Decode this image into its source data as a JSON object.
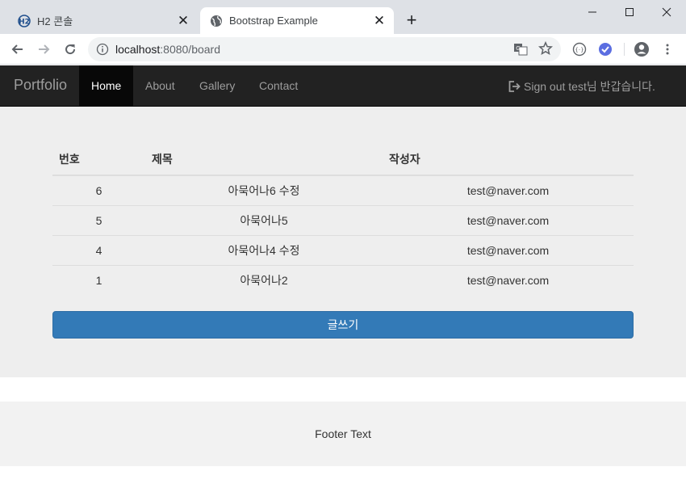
{
  "browser": {
    "tabs": [
      {
        "title": "H2 콘솔",
        "active": false
      },
      {
        "title": "Bootstrap Example",
        "active": true
      }
    ],
    "url": {
      "host": "localhost",
      "path": ":8080/board"
    }
  },
  "navbar": {
    "brand": "Portfolio",
    "links": [
      "Home",
      "About",
      "Gallery",
      "Contact"
    ],
    "active_link": "Home",
    "right_text": "Sign out test님 반갑습니다."
  },
  "board": {
    "headers": [
      "번호",
      "제목",
      "작성자"
    ],
    "rows": [
      {
        "num": "6",
        "title": "아묵어나6 수정",
        "writer": "test@naver.com"
      },
      {
        "num": "5",
        "title": "아묵어나5",
        "writer": "test@naver.com"
      },
      {
        "num": "4",
        "title": "아묵어나4 수정",
        "writer": "test@naver.com"
      },
      {
        "num": "1",
        "title": "아묵어나2",
        "writer": "test@naver.com"
      }
    ],
    "write_button": "글쓰기"
  },
  "footer": {
    "text": "Footer Text"
  },
  "colors": {
    "navbar_bg": "#222222",
    "primary": "#337ab7",
    "content_bg": "#eeeeee"
  }
}
